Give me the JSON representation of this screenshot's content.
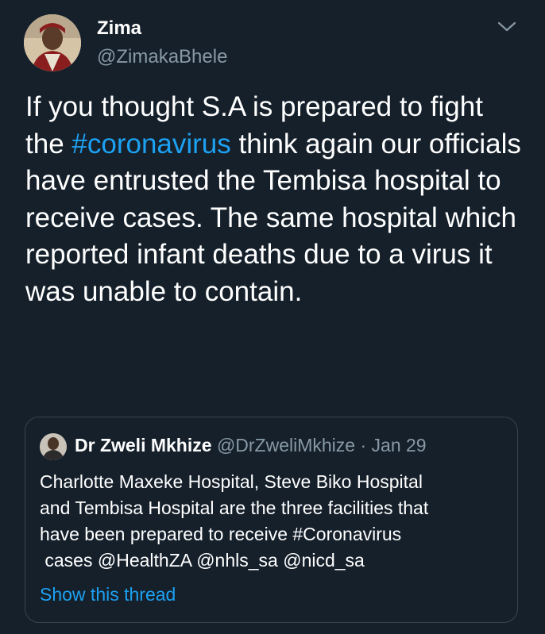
{
  "author": {
    "name": "Zima",
    "handle": "@ZimakaBhele"
  },
  "tweet": {
    "text_before_hashtag": "If you thought S.A is prepared to fight the ",
    "hashtag": "#coronavirus",
    "text_after_hashtag": " think again our officials have entrusted the Tembisa hospital to receive cases. The same hospital which reported infant deaths due to a virus it was unable to contain."
  },
  "quoted_tweet": {
    "name": "Dr Zweli Mkhize",
    "handle": "@DrZweliMkhize",
    "separator": " · ",
    "date": "Jan 29",
    "line1": "Charlotte Maxeke Hospital, Steve Biko Hospital",
    "line2": "and Tembisa Hospital are the three facilities that",
    "line3": "have been prepared to receive #Coronavirus",
    "line4": " cases @HealthZA @nhls_sa @nicd_sa",
    "show_thread": "Show this thread"
  },
  "colors": {
    "background": "#15202b",
    "text": "#ffffff",
    "secondary_text": "#8899a6",
    "link": "#1da1f2",
    "border": "#38444d"
  },
  "icons": {
    "menu": "chevron-down-icon"
  }
}
